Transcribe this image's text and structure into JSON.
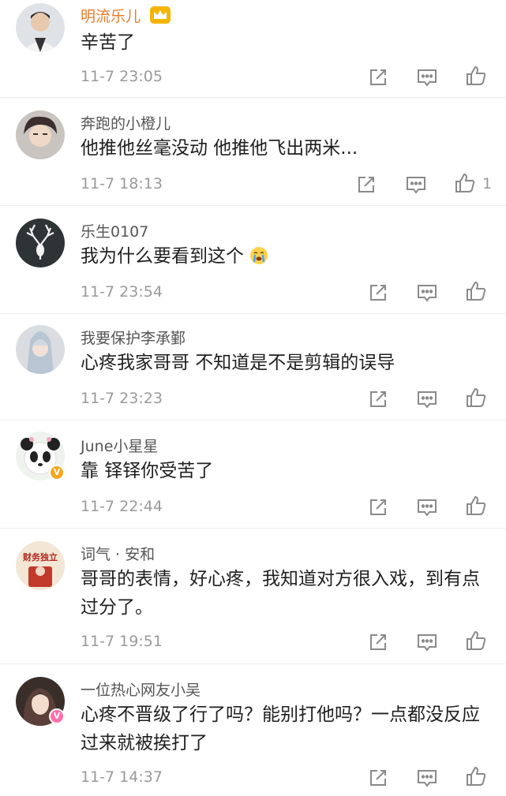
{
  "comments": [
    {
      "user": "明流乐儿",
      "text": "辛苦了",
      "time": "11-7 23:05",
      "likes": ""
    },
    {
      "user": "奔跑的小橙儿",
      "text": "他推他丝毫没动 他推他飞出两米...",
      "time": "11-7 18:13",
      "likes": "1"
    },
    {
      "user": "乐生0107",
      "text": "我为什么要看到这个",
      "time": "11-7 23:54",
      "likes": ""
    },
    {
      "user": "我要保护李承鄞",
      "text": "心疼我家哥哥  不知道是不是剪辑的误导",
      "time": "11-7 23:23",
      "likes": ""
    },
    {
      "user": "June小星星",
      "text": "靠 铎铎你受苦了",
      "time": "11-7 22:44",
      "likes": ""
    },
    {
      "user": "词气 · 安和",
      "text": "哥哥的表情，好心疼，我知道对方很入戏，到有点过分了。",
      "time": "11-7 19:51",
      "likes": ""
    },
    {
      "user": "一位热心网友小吴",
      "text": "心疼不晋级了行了吗？能别打他吗？一点都没反应过来就被挨打了",
      "time": "11-7 14:37",
      "likes": ""
    }
  ],
  "icons": {
    "share": "share-icon",
    "reply": "comment-icon",
    "like": "thumbs-up-icon",
    "vip": "crown-icon",
    "verified": "v-badge-icon",
    "emoji": "crying-emoji-icon"
  },
  "avatar_text": "财务独立",
  "colors": {
    "vip_name": "#e87b2c",
    "gray_text": "#9a9a9a",
    "divider": "#ececec"
  }
}
